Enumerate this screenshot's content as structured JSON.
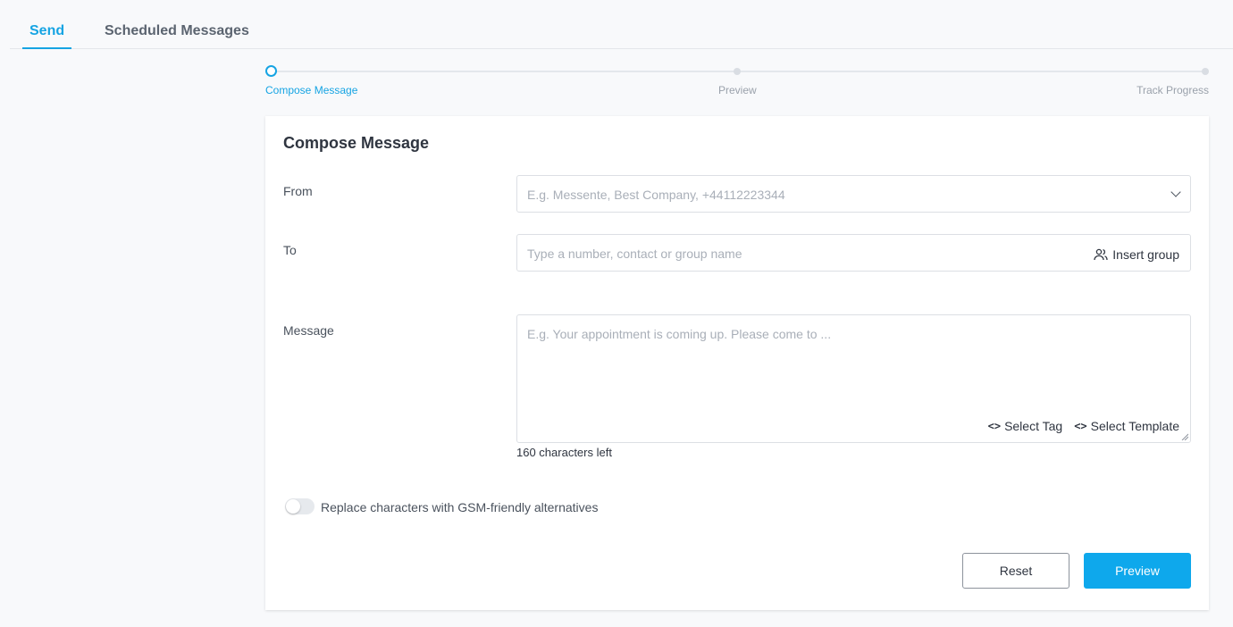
{
  "tabs": [
    {
      "label": "Send",
      "active": true
    },
    {
      "label": "Scheduled Messages",
      "active": false
    }
  ],
  "stepper": {
    "steps": [
      {
        "label": "Compose Message",
        "active": true
      },
      {
        "label": "Preview",
        "active": false
      },
      {
        "label": "Track Progress",
        "active": false
      }
    ]
  },
  "compose": {
    "title": "Compose Message",
    "from": {
      "label": "From",
      "placeholder": "E.g. Messente, Best Company, +44112223344",
      "value": ""
    },
    "to": {
      "label": "To",
      "placeholder": "Type a number, contact or group name",
      "value": "",
      "insert_group_label": "Insert group"
    },
    "message": {
      "label": "Message",
      "placeholder": "E.g. Your appointment is coming up. Please come to ...",
      "value": "",
      "select_tag_label": "Select Tag",
      "select_template_label": "Select Template",
      "chars_left": "160 characters left"
    },
    "gsm_toggle": {
      "label": "Replace characters with GSM-friendly alternatives",
      "enabled": false
    },
    "buttons": {
      "reset_label": "Reset",
      "preview_label": "Preview"
    }
  },
  "colors": {
    "accent": "#16a4e3",
    "primary_button": "#0ea8ec"
  }
}
